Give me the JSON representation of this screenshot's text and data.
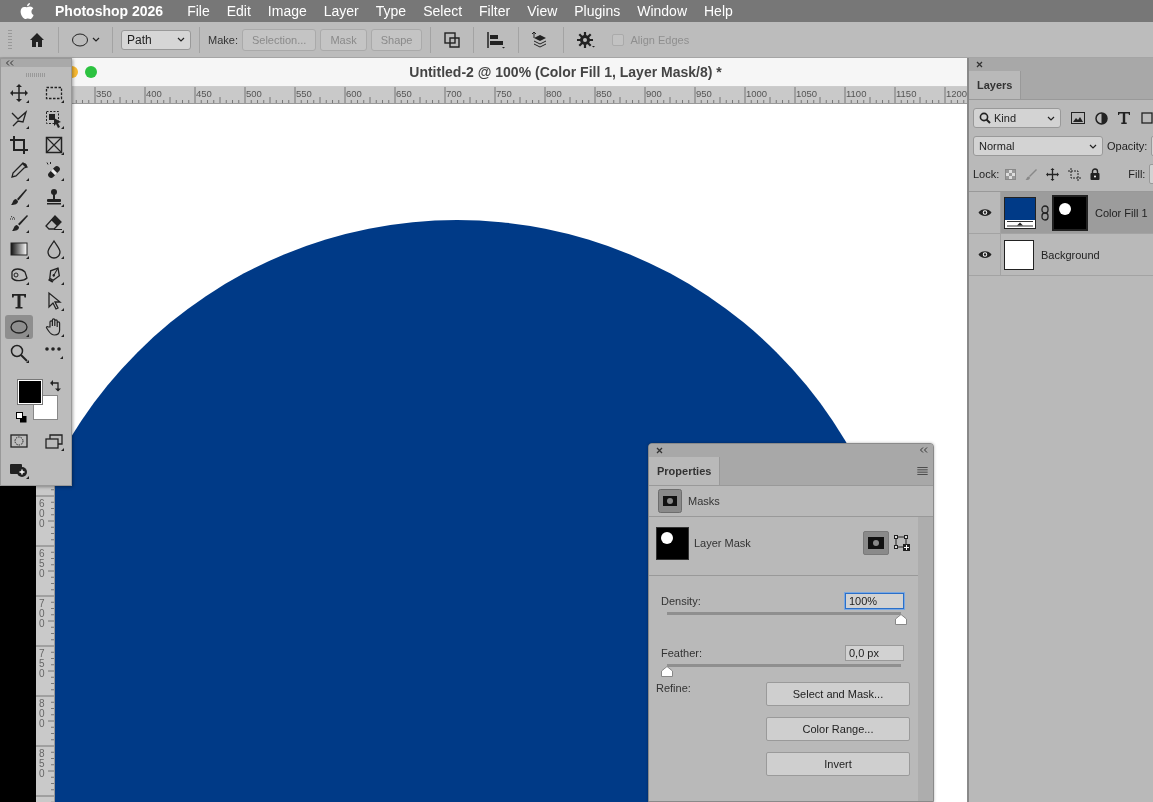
{
  "menu_bar": {
    "app_name": "Photoshop 2026",
    "items": [
      "File",
      "Edit",
      "Image",
      "Layer",
      "Type",
      "Select",
      "Filter",
      "View",
      "Plugins",
      "Window",
      "Help"
    ]
  },
  "options_bar": {
    "mode": "Path",
    "make_label": "Make:",
    "make_buttons": [
      {
        "label": "Selection...",
        "disabled": true
      },
      {
        "label": "Mask",
        "disabled": true
      },
      {
        "label": "Shape",
        "disabled": true
      }
    ],
    "align_edges": {
      "label": "Align Edges",
      "checked": false,
      "disabled": true
    }
  },
  "document": {
    "title": "Untitled-2 @ 100% (Color Fill 1, Layer Mask/8) *",
    "ruler_horizontal": [
      "350",
      "400",
      "450",
      "500",
      "550",
      "600",
      "650",
      "700",
      "750",
      "800",
      "850",
      "900",
      "950",
      "1000",
      "1050",
      "1100",
      "1150",
      "1200"
    ],
    "ruler_vertical": [
      "600",
      "650",
      "700",
      "750",
      "800",
      "850"
    ]
  },
  "toolbar": {
    "tools": [
      {
        "kind": "move",
        "selected": false
      },
      {
        "kind": "marquee",
        "selected": false
      },
      {
        "kind": "lasso",
        "selected": false
      },
      {
        "kind": "objectselect",
        "selected": false
      },
      {
        "kind": "crop",
        "selected": false
      },
      {
        "kind": "frame",
        "selected": false
      },
      {
        "kind": "eyedropper",
        "selected": false
      },
      {
        "kind": "healing",
        "selected": false
      },
      {
        "kind": "brush",
        "selected": false
      },
      {
        "kind": "stamp",
        "selected": false
      },
      {
        "kind": "history",
        "selected": false
      },
      {
        "kind": "eraser",
        "selected": false
      },
      {
        "kind": "gradient",
        "selected": false
      },
      {
        "kind": "blur",
        "selected": false
      },
      {
        "kind": "remove",
        "selected": false
      },
      {
        "kind": "pen",
        "selected": false
      },
      {
        "kind": "type",
        "selected": false
      },
      {
        "kind": "pathselect",
        "selected": false
      },
      {
        "kind": "ellipse",
        "selected": true
      },
      {
        "kind": "hand",
        "selected": false
      },
      {
        "kind": "zoom",
        "selected": false
      },
      {
        "kind": "more",
        "selected": false
      }
    ]
  },
  "layers_panel": {
    "tabs": [
      {
        "label": "Layers",
        "selected": true
      }
    ],
    "filter": "Kind",
    "blend_mode": "Normal",
    "opacity_label": "Opacity:",
    "lock_label": "Lock:",
    "fill_label": "Fill:",
    "layers": [
      {
        "name": "Color Fill 1",
        "kind": "fill",
        "visible": true,
        "selected": true
      },
      {
        "name": "Background",
        "kind": "background",
        "visible": true,
        "selected": false
      }
    ]
  },
  "properties_panel": {
    "tabs": [
      {
        "label": "Properties",
        "selected": true
      }
    ],
    "section": "Masks",
    "mask_name": "Layer Mask",
    "density": {
      "label": "Density:",
      "value": "100%",
      "level": 1,
      "focused": true
    },
    "feather": {
      "label": "Feather:",
      "value": "0,0 px",
      "level": 0,
      "focused": false
    },
    "refine_label": "Refine:",
    "buttons": [
      "Select and Mask...",
      "Color Range...",
      "Invert"
    ]
  }
}
